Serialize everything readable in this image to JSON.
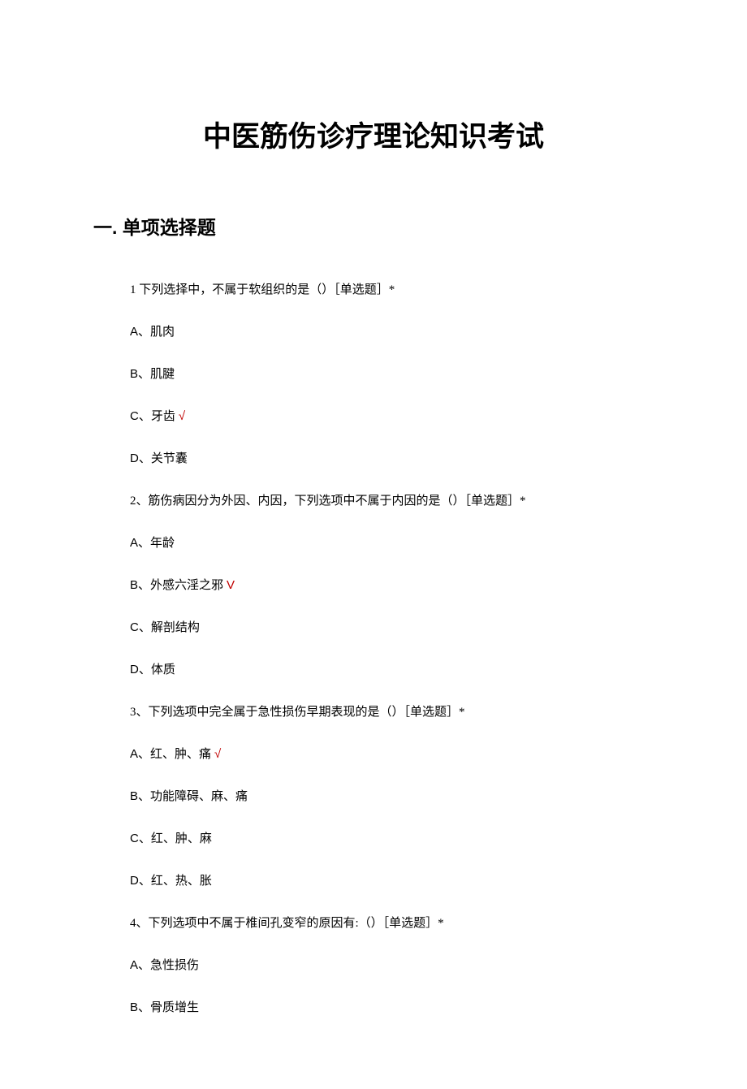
{
  "title": "中医筋伤诊疗理论知识考试",
  "section_heading": "一. 单项选择题",
  "questions": [
    {
      "text": "1 下列选择中，不属于软组织的是（）［单选题］*",
      "options": [
        {
          "letter": "A",
          "text": "肌肉",
          "correct": false
        },
        {
          "letter": "B",
          "text": "肌腱",
          "correct": false
        },
        {
          "letter": "C",
          "text": "牙齿",
          "correct": true,
          "mark": "√"
        },
        {
          "letter": "D",
          "text": "关节囊",
          "correct": false
        }
      ]
    },
    {
      "text": "2、筋伤病因分为外因、内因，下列选项中不属于内因的是（）［单选题］*",
      "options": [
        {
          "letter": "A",
          "text": "年龄",
          "correct": false
        },
        {
          "letter": "B",
          "text": "外感六淫之邪",
          "correct": true,
          "mark": "V"
        },
        {
          "letter": "C",
          "text": "解剖结构",
          "correct": false
        },
        {
          "letter": "D",
          "text": "体质",
          "correct": false
        }
      ]
    },
    {
      "text": "3、下列选项中完全属于急性损伤早期表现的是（）［单选题］*",
      "options": [
        {
          "letter": "A",
          "text": "红、肿、痛",
          "correct": true,
          "mark": "√"
        },
        {
          "letter": "B",
          "text": "功能障碍、麻、痛",
          "correct": false
        },
        {
          "letter": "C",
          "text": "红、肿、麻",
          "correct": false
        },
        {
          "letter": "D",
          "text": "红、热、胀",
          "correct": false
        }
      ]
    },
    {
      "text": "4、下列选项中不属于椎间孔变窄的原因有:（）［单选题］*",
      "options": [
        {
          "letter": "A",
          "text": "急性损伤",
          "correct": false
        },
        {
          "letter": "B",
          "text": "骨质增生",
          "correct": false
        }
      ]
    }
  ]
}
